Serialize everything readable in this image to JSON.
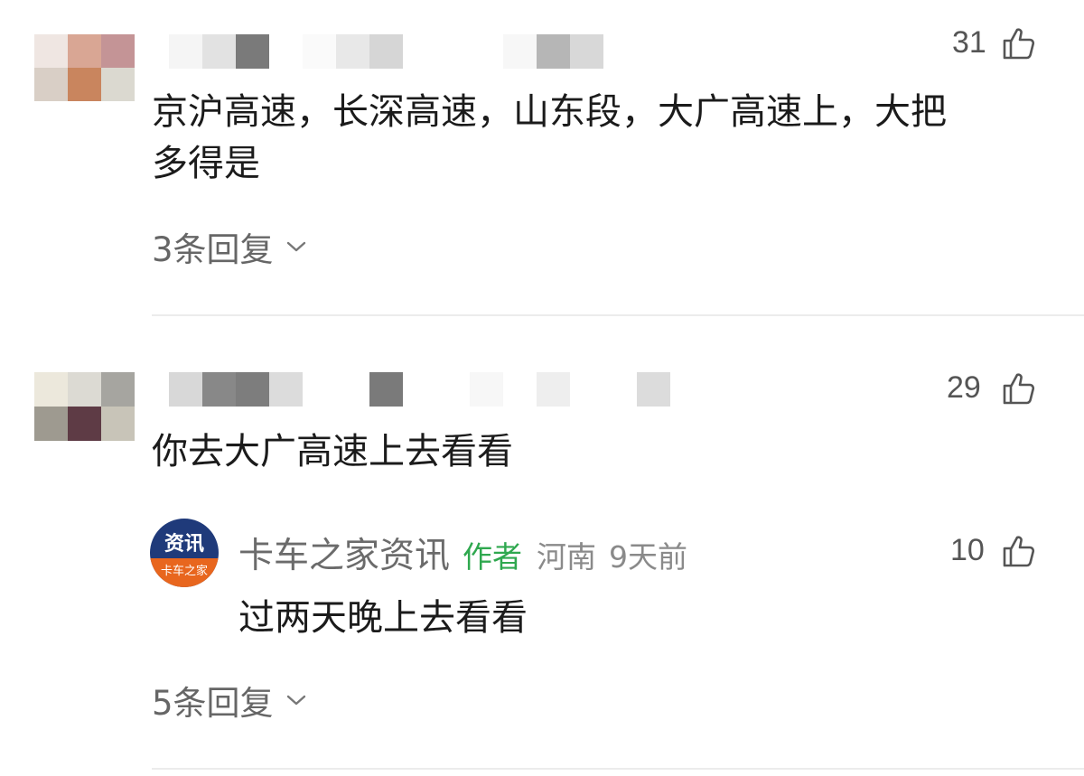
{
  "comments": [
    {
      "likes": "31",
      "text_line1": "京沪高速，长深高速，山东段，大广高速上，大把",
      "text_line2": "多得是",
      "replies_label": "3条回复",
      "avatar_colors": [
        "#efe6e2",
        "#d9a694",
        "#c49496",
        "#d9cfc6",
        "#c9855e",
        "#dbd9d0"
      ],
      "name_colors": [
        "#f5f5f5",
        "#e2e2e2",
        "#7a7a7a",
        "#ffffff",
        "#fafafa",
        "#e8e8e8",
        "#d6d6d6",
        "#ffffff",
        "#ffffff",
        "#ffffff",
        "#f7f7f7",
        "#b6b6b6",
        "#d8d8d8",
        "#ffffff"
      ]
    },
    {
      "likes": "29",
      "text": "你去大广高速上去看看",
      "replies_label": "5条回复",
      "avatar_colors": [
        "#ece8dc",
        "#dcdad3",
        "#a6a5a0",
        "#9e9a90",
        "#5e3b45",
        "#c8c4b8"
      ],
      "name_colors": [
        "#d8d8d8",
        "#888888",
        "#7d7d7d",
        "#dcdcdc",
        "#ffffff",
        "#ffffff",
        "#7a7a7a",
        "#ffffff",
        "#ffffff",
        "#f7f7f7",
        "#ffffff",
        "#eeeeee",
        "#ffffff",
        "#ffffff",
        "#dcdcdc"
      ]
    }
  ],
  "reply": {
    "logo_top": "资讯",
    "logo_bottom": "卡车之家",
    "author": "卡车之家资讯",
    "tag": "作者",
    "location": "河南",
    "time": "9天前",
    "likes": "10",
    "text": "过两天晚上去看看"
  },
  "colors": {
    "author_tag": "#2fa84f",
    "logo_bg": "#1f3a7a",
    "logo_band": "#e8661e"
  },
  "icons": [
    "thumb-up-icon",
    "chevron-down-icon"
  ]
}
